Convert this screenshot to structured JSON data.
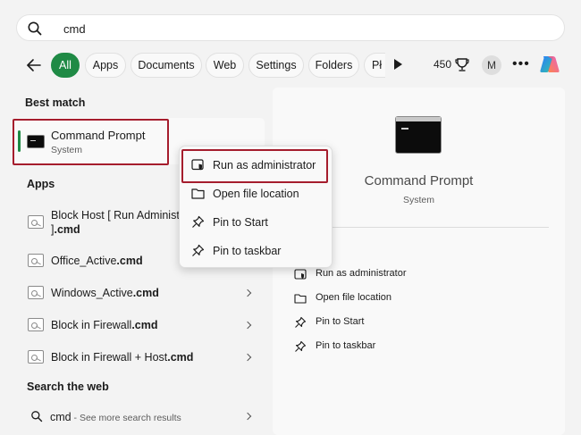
{
  "search": {
    "query": "cmd"
  },
  "filters": {
    "tabs": [
      {
        "label": "All",
        "active": true
      },
      {
        "label": "Apps"
      },
      {
        "label": "Documents"
      },
      {
        "label": "Web"
      },
      {
        "label": "Settings"
      },
      {
        "label": "Folders"
      },
      {
        "label": "Pł"
      }
    ],
    "points": "450",
    "avatar_initial": "M",
    "accent_color": "#1f8a45"
  },
  "best_match": {
    "heading": "Best match",
    "title": "Command Prompt",
    "subtitle": "System"
  },
  "apps": {
    "heading": "Apps",
    "items": [
      {
        "line1": "Block Host [ Run Administra",
        "line2_prefix": "]",
        "line2_bold": ".cmd"
      },
      {
        "name": "Office_Active",
        "ext": ".cmd"
      },
      {
        "name": "Windows_Active",
        "ext": ".cmd"
      },
      {
        "name": "Block in Firewall",
        "ext": ".cmd"
      },
      {
        "name": "Block in Firewall + Host",
        "ext": ".cmd"
      }
    ]
  },
  "web": {
    "heading": "Search the web",
    "query": "cmd",
    "hint": " - See more search results"
  },
  "context_menu": {
    "items": [
      {
        "label": "Run as administrator",
        "icon": "shield-admin-icon"
      },
      {
        "label": "Open file location",
        "icon": "folder-icon"
      },
      {
        "label": "Pin to Start",
        "icon": "pin-icon"
      },
      {
        "label": "Pin to taskbar",
        "icon": "pin-icon"
      }
    ],
    "highlight_color": "#a51d2d"
  },
  "preview": {
    "title": "Command Prompt",
    "subtitle": "System",
    "actions": [
      {
        "label": "Open",
        "visible_text": "n"
      },
      {
        "label": "Run as administrator"
      },
      {
        "label": "Open file location"
      },
      {
        "label": "Pin to Start"
      },
      {
        "label": "Pin to taskbar"
      }
    ]
  }
}
